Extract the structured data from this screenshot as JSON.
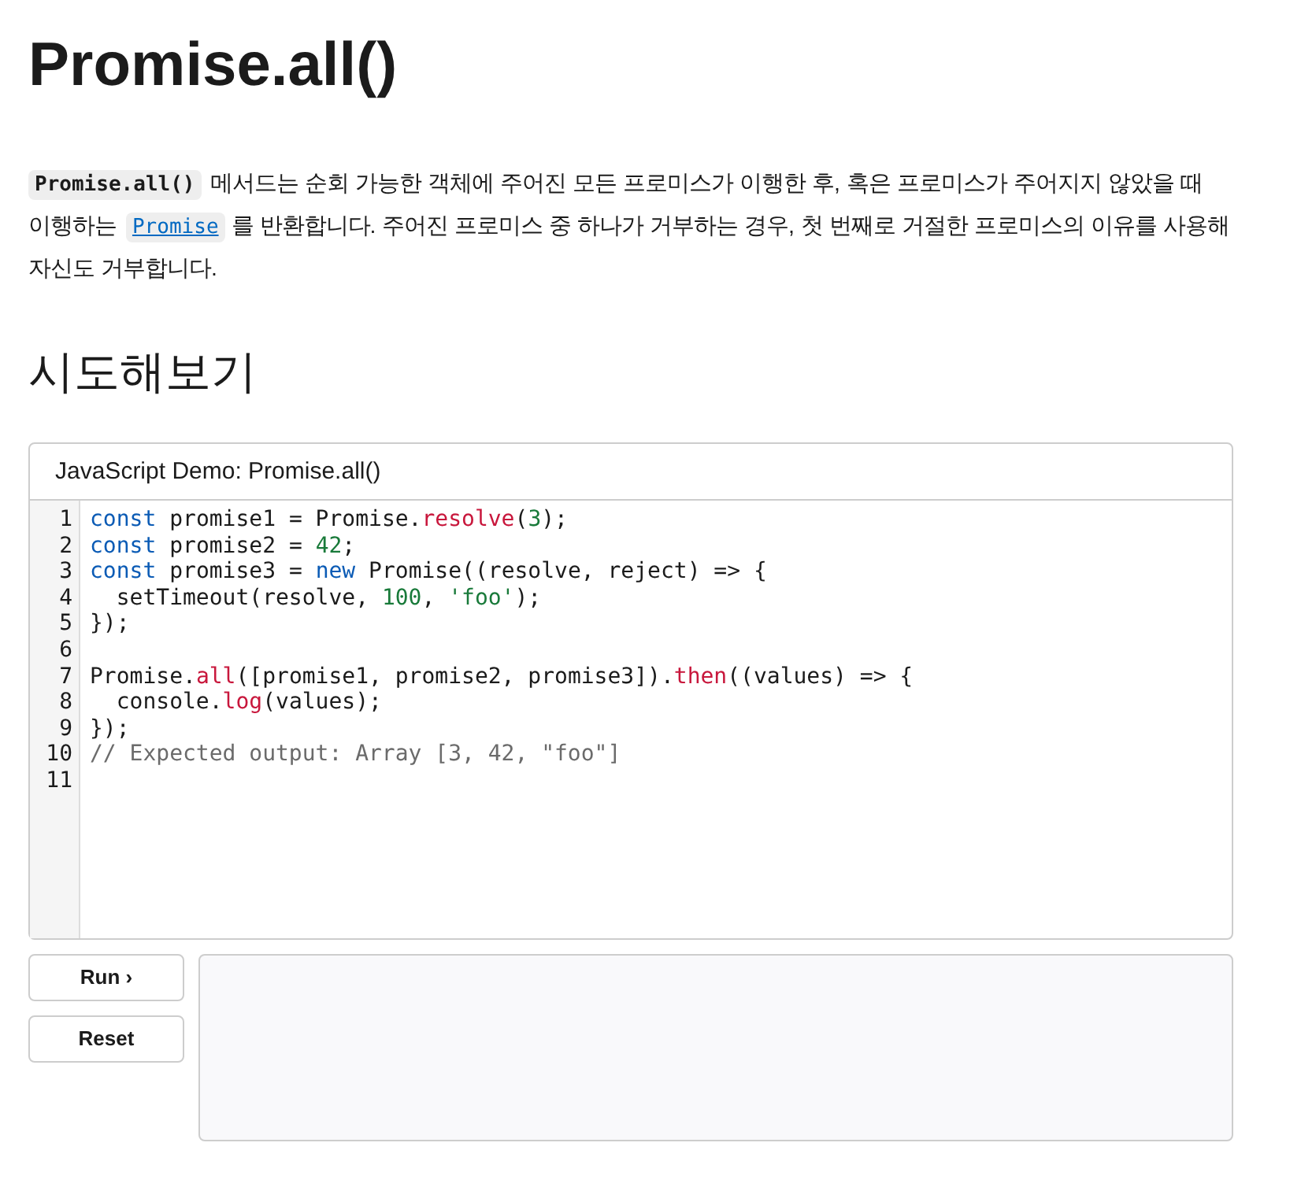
{
  "title": "Promise.all()",
  "description": [
    {
      "kind": "code",
      "text": "Promise.all()"
    },
    {
      "kind": "text",
      "text": " 메서드는 순회 가능한 객체에 주어진 모든 프로미스가 이행한 후, 혹은 프로미스가 주어지지 않았을 때 이행하는 "
    },
    {
      "kind": "link",
      "text": "Promise"
    },
    {
      "kind": "text",
      "text": "를 반환합니다. 주어진 프로미스 중 하나가 거부하는 경우, 첫 번째로 거절한 프로미스의 이유를 사용해 자신도 거부합니다."
    }
  ],
  "section_heading": "시도해보기",
  "demo": {
    "title": "JavaScript Demo: Promise.all()",
    "code_lines": [
      {
        "number": "1",
        "tokens": [
          {
            "kind": "keyword",
            "text": "const"
          },
          {
            "kind": "plain",
            "text": " promise1 = Promise."
          },
          {
            "kind": "function",
            "text": "resolve"
          },
          {
            "kind": "plain",
            "text": "("
          },
          {
            "kind": "number",
            "text": "3"
          },
          {
            "kind": "plain",
            "text": ");"
          }
        ]
      },
      {
        "number": "2",
        "tokens": [
          {
            "kind": "keyword",
            "text": "const"
          },
          {
            "kind": "plain",
            "text": " promise2 = "
          },
          {
            "kind": "number",
            "text": "42"
          },
          {
            "kind": "plain",
            "text": ";"
          }
        ]
      },
      {
        "number": "3",
        "tokens": [
          {
            "kind": "keyword",
            "text": "const"
          },
          {
            "kind": "plain",
            "text": " promise3 = "
          },
          {
            "kind": "keyword",
            "text": "new"
          },
          {
            "kind": "plain",
            "text": " Promise((resolve, reject) => {"
          }
        ]
      },
      {
        "number": "4",
        "tokens": [
          {
            "kind": "plain",
            "text": "  setTimeout(resolve, "
          },
          {
            "kind": "number",
            "text": "100"
          },
          {
            "kind": "plain",
            "text": ", "
          },
          {
            "kind": "string",
            "text": "'foo'"
          },
          {
            "kind": "plain",
            "text": ");"
          }
        ]
      },
      {
        "number": "5",
        "tokens": [
          {
            "kind": "plain",
            "text": "});"
          }
        ]
      },
      {
        "number": "6"
      },
      {
        "number": "7",
        "tokens": [
          {
            "kind": "plain",
            "text": "Promise."
          },
          {
            "kind": "function",
            "text": "all"
          },
          {
            "kind": "plain",
            "text": "([promise1, promise2, promise3])."
          },
          {
            "kind": "function",
            "text": "then"
          },
          {
            "kind": "plain",
            "text": "((values) => {"
          }
        ]
      },
      {
        "number": "8",
        "tokens": [
          {
            "kind": "plain",
            "text": "  console."
          },
          {
            "kind": "function",
            "text": "log"
          },
          {
            "kind": "plain",
            "text": "(values);"
          }
        ]
      },
      {
        "number": "9",
        "tokens": [
          {
            "kind": "plain",
            "text": "});"
          }
        ]
      },
      {
        "number": "10",
        "tokens": [
          {
            "kind": "comment",
            "text": "// Expected output: Array [3, 42, \"foo\"]"
          }
        ]
      },
      {
        "number": "11"
      }
    ],
    "buttons": [
      {
        "label": "Run ›"
      },
      {
        "label": "Reset"
      }
    ]
  }
}
